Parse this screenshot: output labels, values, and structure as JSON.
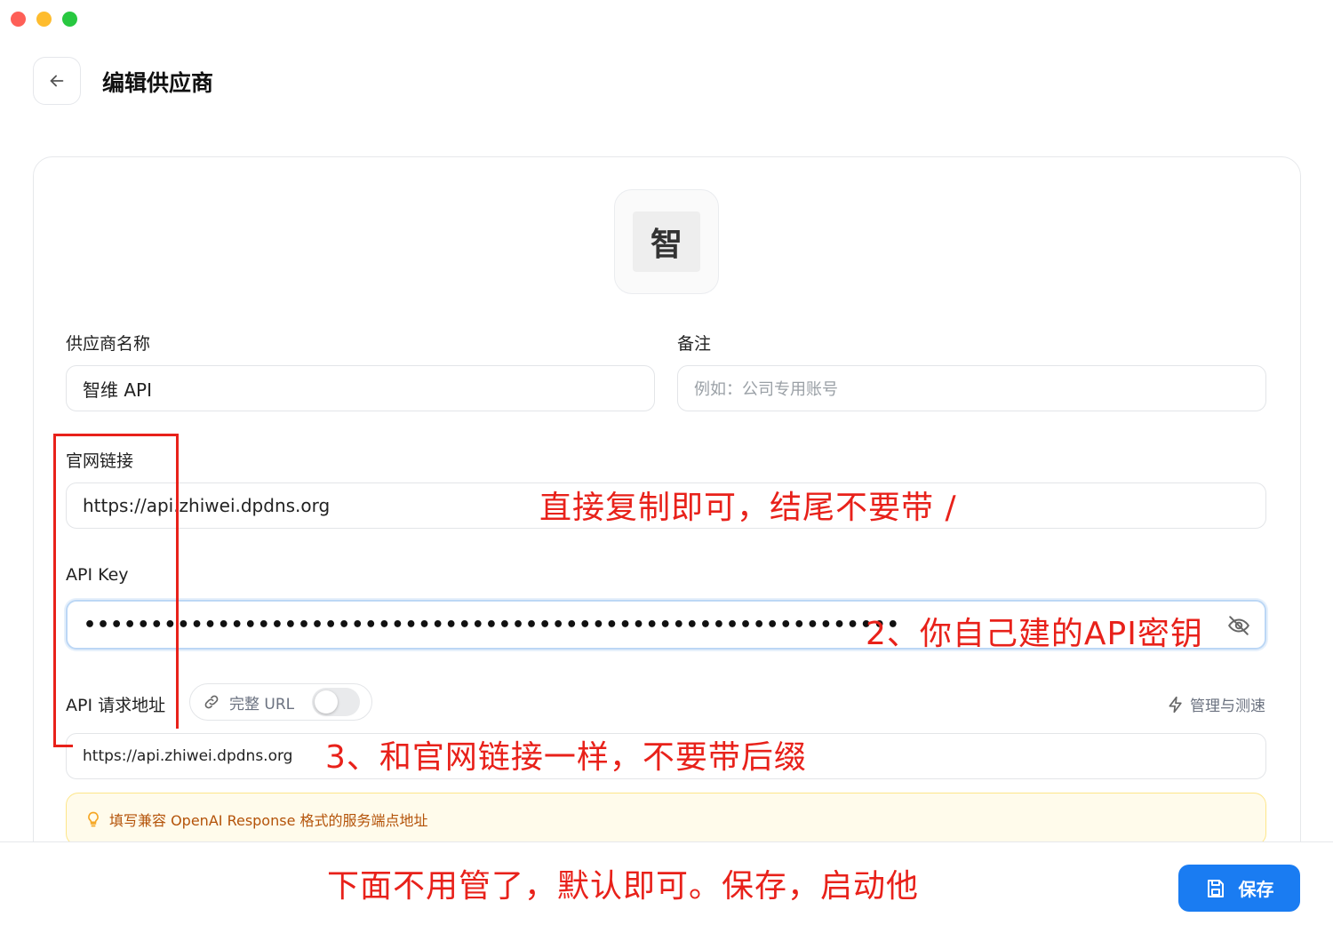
{
  "window": {
    "traffic_lights": [
      "close",
      "minimize",
      "zoom"
    ]
  },
  "header": {
    "back_icon": "arrow-left-icon",
    "title": "编辑供应商"
  },
  "provider": {
    "logo_char": "智"
  },
  "form": {
    "name_label": "供应商名称",
    "name_value": "智维 API",
    "note_label": "备注",
    "note_placeholder": "例如：公司专用账号",
    "website_label": "官网链接",
    "website_value": "https://api.zhiwei.dpdns.org",
    "apikey_label": "API Key",
    "apikey_masked": "•••••••••••••••••••••••••••••••••••••••••••••••••••••••••••••",
    "endpoint_label": "API 请求地址",
    "full_url_label": "完整 URL",
    "full_url_enabled": false,
    "manage_label": "管理与测速",
    "endpoint_value": "https://api.zhiwei.dpdns.org",
    "hint_text": "填写兼容 OpenAI Response 格式的服务端点地址"
  },
  "footer": {
    "save_label": "保存"
  },
  "annotations": {
    "a1": "直接复制即可，结尾不要带 /",
    "a2": "2、你自己建的API密钥",
    "a3": "3、和官网链接一样，不要带后缀",
    "a4": "下面不用管了，默认即可。保存，启动他"
  },
  "colors": {
    "accent": "#1a7cf2",
    "annotation": "#e8211a",
    "hint_bg": "#fffbeb",
    "hint_text": "#b45309"
  }
}
